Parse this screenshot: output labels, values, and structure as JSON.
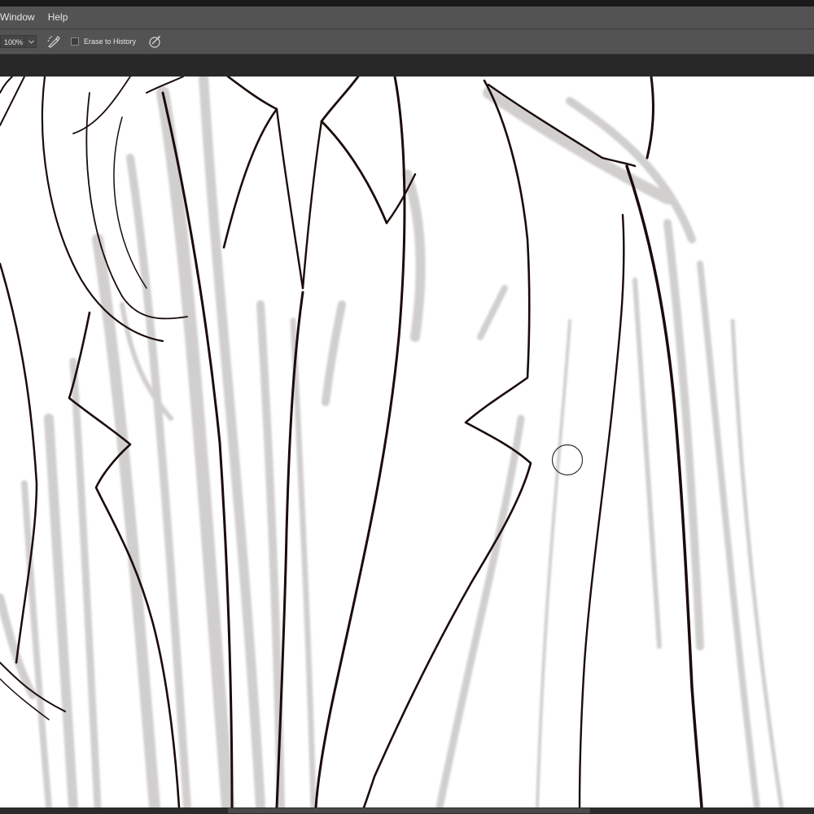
{
  "menu": {
    "items": [
      {
        "label": "Window"
      },
      {
        "label": "Help"
      }
    ]
  },
  "options_bar": {
    "zoom_value": "100%",
    "erase_to_history": {
      "label": "Erase to History",
      "checked": false
    },
    "icons": [
      "airbrush-icon",
      "chevron-down-icon",
      "pressure-size-icon"
    ]
  },
  "canvas": {
    "background": "#ffffff",
    "line_color": "#1a0c0a",
    "sketch_color": "#c9c6c6",
    "cursor": "brush-cursor-icon"
  },
  "colors": {
    "menubar": "#535353",
    "options_bar": "#535353",
    "workspace": "#282828",
    "scrollbar": "#2b2b2b"
  }
}
